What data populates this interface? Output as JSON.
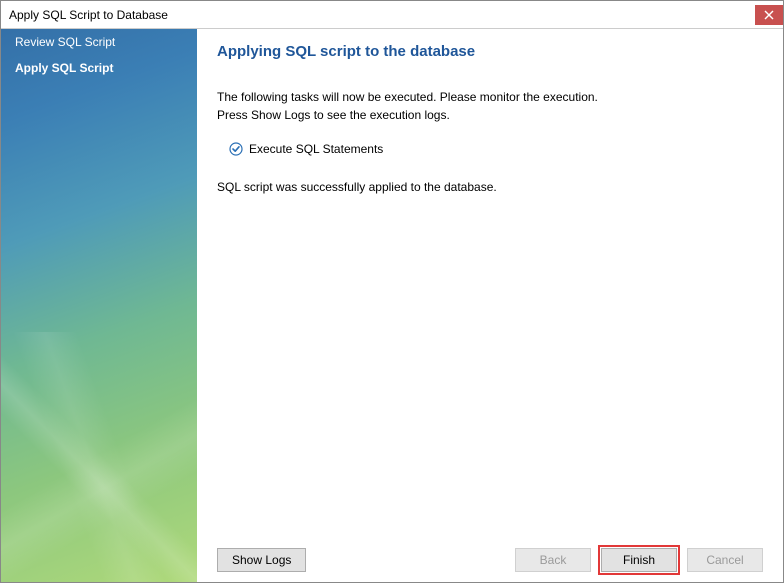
{
  "window": {
    "title": "Apply SQL Script to Database"
  },
  "sidebar": {
    "items": [
      {
        "label": "Review SQL Script",
        "active": false
      },
      {
        "label": "Apply SQL Script",
        "active": true
      }
    ]
  },
  "content": {
    "heading": "Applying SQL script to the database",
    "instruction_line1": "The following tasks will now be executed. Please monitor the execution.",
    "instruction_line2": "Press Show Logs to see the execution logs.",
    "task_label": "Execute SQL Statements",
    "success_message": "SQL script was successfully applied to the database."
  },
  "footer": {
    "show_logs_label": "Show Logs",
    "back_label": "Back",
    "finish_label": "Finish",
    "cancel_label": "Cancel"
  }
}
